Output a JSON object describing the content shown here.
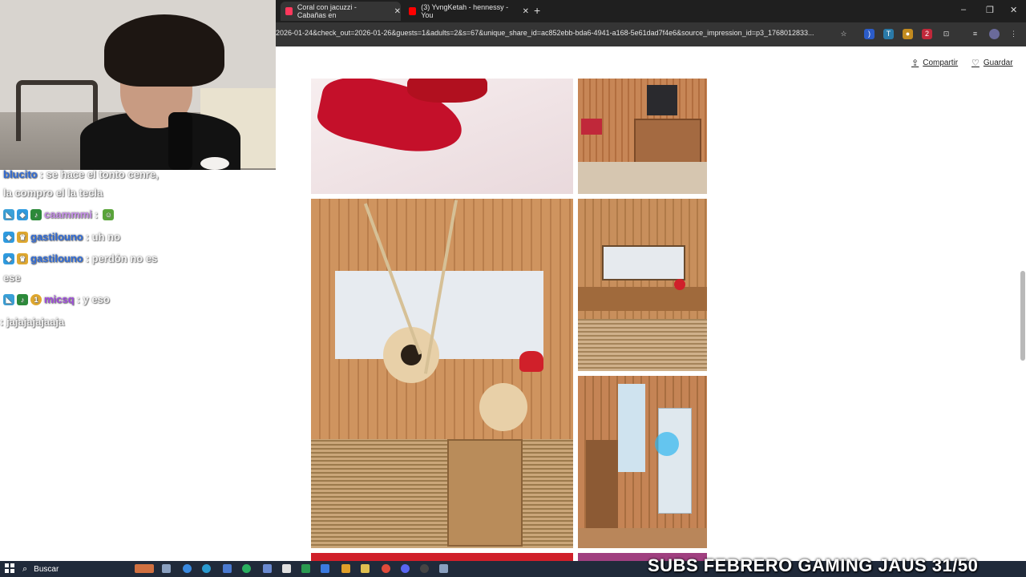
{
  "chat": {
    "lines": [
      {
        "user": "blucito",
        "msg": ": se hace el tonto cenre,",
        "user_color": "#2f6bd8"
      },
      {
        "user": "",
        "msg": "la compro el la tecla",
        "user_color": "#ffffff"
      },
      {
        "user": "caammmi",
        "msg": ":",
        "user_color": "#c58ee8"
      },
      {
        "user": "gastilouno",
        "msg": ": uh no",
        "user_color": "#2f6bd8"
      },
      {
        "user": "gastilouno",
        "msg": ": perdón no es",
        "user_color": "#2f6bd8"
      },
      {
        "user": "",
        "msg": "ese",
        "user_color": "#ffffff"
      },
      {
        "user": "micsq",
        "msg": ": y eso",
        "user_color": "#a14be0"
      },
      {
        "user": "",
        "msg": ": jajajajajaaja",
        "user_color": "#ffffff"
      }
    ]
  },
  "browser": {
    "tabs": [
      {
        "title": "Coral con jacuzzi - Cabañas en",
        "active": true,
        "color": "#ff385c"
      },
      {
        "title": "(3) YvngKetah - hennessy - You",
        "active": false,
        "color": "#ff0000"
      }
    ],
    "new_tab": "+",
    "url": "2026-01-24&check_out=2026-01-26&guests=1&adults=2&s=67&unique_share_id=ac852ebb-bda6-4941-a168-5e61dad7f4e6&source_impression_id=p3_1768012833...",
    "window_controls": [
      "–",
      "❐",
      "✕"
    ]
  },
  "page": {
    "share_label": "Compartir",
    "save_label": "Guardar",
    "photos": [
      {
        "name": "photo-red-pillow",
        "desc_color": "#f0dfe0"
      },
      {
        "name": "photo-tv-cabinet",
        "desc_color": "#b5764a"
      },
      {
        "name": "photo-dried-flowers",
        "desc_color": "#c58c5a"
      },
      {
        "name": "photo-kitchen",
        "desc_color": "#b98454"
      },
      {
        "name": "photo-fridge",
        "desc_color": "#b17548"
      }
    ]
  },
  "taskbar": {
    "search_placeholder": "Buscar",
    "overlay_text": "SUBS FEBRERO GAMING JAUS 31/50"
  },
  "colors": {
    "accent": "#ff385c",
    "chrome_dark": "#1f1f1f",
    "taskbar": "#202a3a"
  }
}
